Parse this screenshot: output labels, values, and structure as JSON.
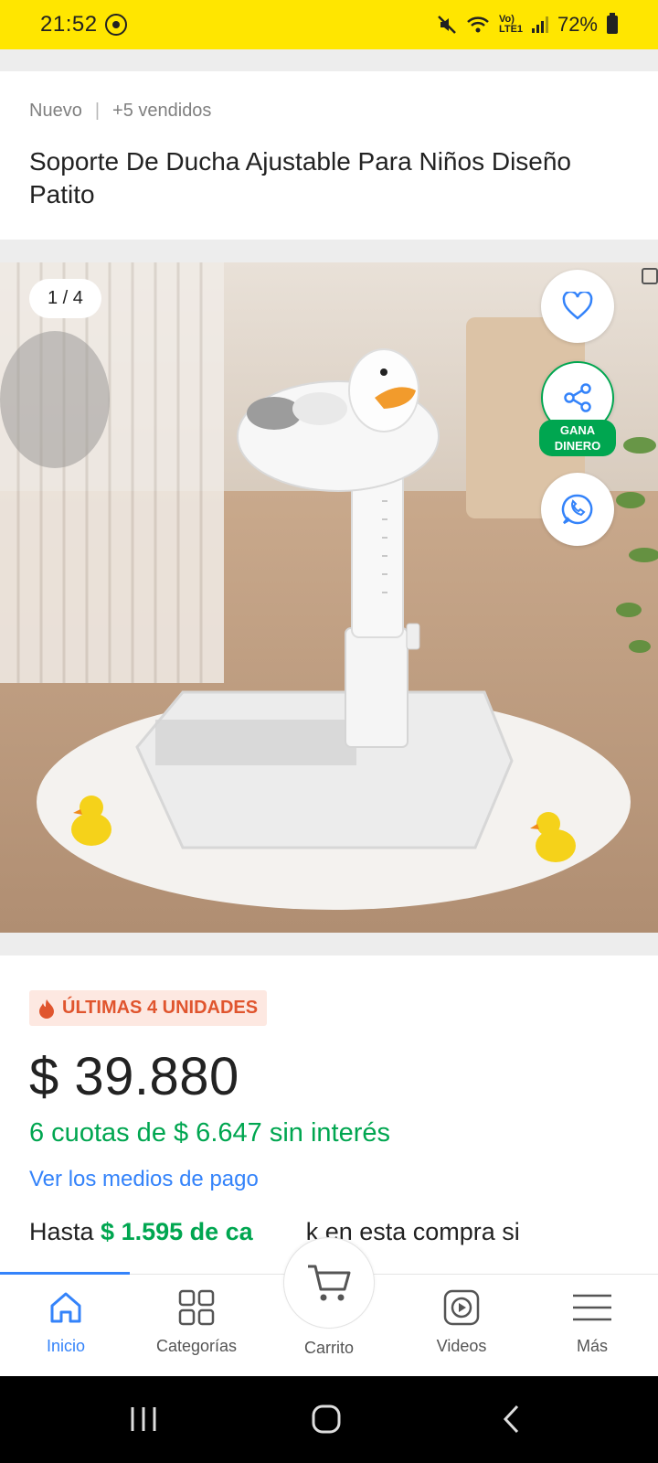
{
  "status": {
    "time": "21:52",
    "battery": "72%",
    "network": "Vo) LTE1"
  },
  "listing": {
    "condition": "Nuevo",
    "separator": "|",
    "sold": "+5 vendidos",
    "title": "Soporte De Ducha Ajustable Para Niños Diseño Patito"
  },
  "gallery": {
    "counter": "1 / 4",
    "earn_label_1": "GANA",
    "earn_label_2": "DINERO"
  },
  "purchase": {
    "stock_badge": "ÚLTIMAS 4 UNIDADES",
    "price": "$ 39.880",
    "installments": "6 cuotas de $ 6.647 sin interés",
    "payment_link": "Ver los medios de pago",
    "cashback_prefix": "Hasta ",
    "cashback_amount": "$ 1.595 de ca",
    "cashback_suffix": "k en esta compra si"
  },
  "tabbar": {
    "home": "Inicio",
    "categories": "Categorías",
    "cart": "Carrito",
    "videos": "Videos",
    "more": "Más"
  },
  "colors": {
    "brand_yellow": "#ffe600",
    "accent_blue": "#3483fa",
    "success_green": "#00a650",
    "urgency_orange": "#e0552e"
  }
}
